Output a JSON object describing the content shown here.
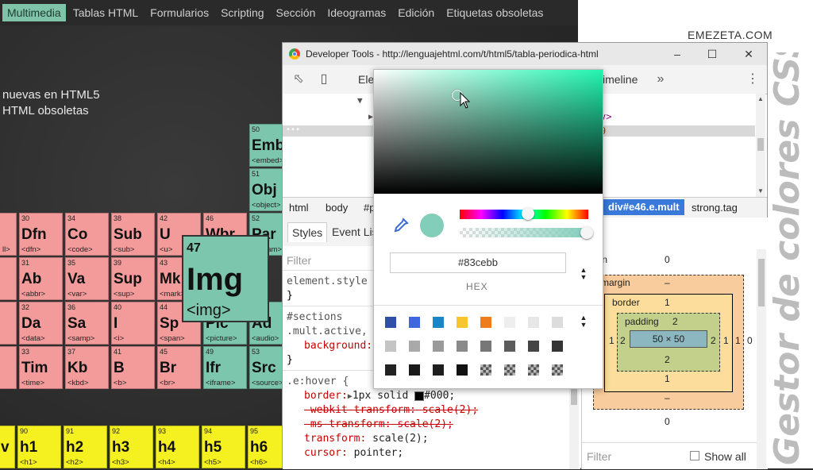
{
  "nav": {
    "items": [
      "Multimedia",
      "Tablas HTML",
      "Formularios",
      "Scripting",
      "Sección",
      "Ideogramas",
      "Edición",
      "Etiquetas obsoletas"
    ]
  },
  "intro": {
    "line1": "nuevas en HTML5",
    "line2": "HTML obsoletas"
  },
  "brand": "EMEZETA.COM",
  "vertical_title": "Gestor de colores CSS",
  "elements": [
    {
      "num": "30",
      "sym": "Dfn",
      "tag": "<dfn>",
      "color": "pink"
    },
    {
      "num": "34",
      "sym": "Co",
      "tag": "<code>",
      "color": "pink"
    },
    {
      "num": "38",
      "sym": "Sub",
      "tag": "<sub>",
      "color": "pink"
    },
    {
      "num": "42",
      "sym": "U",
      "tag": "<u>",
      "color": "pink"
    },
    {
      "num": "46",
      "sym": "Wbr",
      "tag": "<wbr>",
      "color": "pink"
    },
    {
      "num": "52",
      "sym": "Par",
      "tag": "<param>",
      "color": "teal"
    },
    {
      "num": "31",
      "sym": "Ab",
      "tag": "<abbr>",
      "color": "pink"
    },
    {
      "num": "35",
      "sym": "Va",
      "tag": "<var>",
      "color": "pink"
    },
    {
      "num": "39",
      "sym": "Sup",
      "tag": "<sup>",
      "color": "pink"
    },
    {
      "num": "43",
      "sym": "Mk",
      "tag": "<mark>",
      "color": "pink"
    },
    {
      "num": "32",
      "sym": "Da",
      "tag": "<data>",
      "color": "pink"
    },
    {
      "num": "36",
      "sym": "Sa",
      "tag": "<samp>",
      "color": "pink"
    },
    {
      "num": "40",
      "sym": "I",
      "tag": "<i>",
      "color": "pink"
    },
    {
      "num": "44",
      "sym": "Sp",
      "tag": "<span>",
      "color": "pink"
    },
    {
      "num": "48",
      "sym": "Pic",
      "tag": "<picture>",
      "color": "teal"
    },
    {
      "num": "",
      "sym": "Ad",
      "tag": "<audio>",
      "color": "teal"
    },
    {
      "num": "33",
      "sym": "Tim",
      "tag": "<time>",
      "color": "pink"
    },
    {
      "num": "37",
      "sym": "Kb",
      "tag": "<kbd>",
      "color": "pink"
    },
    {
      "num": "41",
      "sym": "B",
      "tag": "<b>",
      "color": "pink"
    },
    {
      "num": "45",
      "sym": "Br",
      "tag": "<br>",
      "color": "pink"
    },
    {
      "num": "49",
      "sym": "Ifr",
      "tag": "<iframe>",
      "color": "teal"
    },
    {
      "num": "53",
      "sym": "Src",
      "tag": "<source>",
      "color": "teal"
    },
    {
      "num": "50",
      "sym": "Emb",
      "tag": "<embed>",
      "color": "teal"
    },
    {
      "num": "51",
      "sym": "Obj",
      "tag": "<object>",
      "color": "teal"
    },
    {
      "num": "90",
      "sym": "h1",
      "tag": "<h1>",
      "color": "yellow"
    },
    {
      "num": "91",
      "sym": "h2",
      "tag": "<h2>",
      "color": "yellow"
    },
    {
      "num": "92",
      "sym": "h3",
      "tag": "<h3>",
      "color": "yellow"
    },
    {
      "num": "93",
      "sym": "h4",
      "tag": "<h4>",
      "color": "yellow"
    },
    {
      "num": "94",
      "sym": "h5",
      "tag": "<h5>",
      "color": "yellow"
    },
    {
      "num": "95",
      "sym": "h6",
      "tag": "<h6>",
      "color": "yellow"
    }
  ],
  "partial_labels": {
    "left1": "ll>",
    "left2": "",
    "yellow_v": "v"
  },
  "featured": {
    "num": "47",
    "sym": "Img",
    "tag": "<img>"
  },
  "devtools": {
    "title": "Developer Tools - http://lenguajehtml.com/t/html5/tabla-periodica-html",
    "tab_elements": "Ele",
    "tab_timeline": "imeline",
    "dom_snip1": "v>",
    "dom_snip2": "9",
    "crumbs": [
      "html",
      "body",
      "#p",
      "div#e46.e.mult",
      "strong.tag"
    ],
    "style_tabs": [
      "Styles",
      "Event Lis"
    ],
    "styles_filter": "Filter",
    "rule1_selector": "element.style",
    "rule1_close": "}",
    "rule2_selector1": "#sections",
    "rule2_selector2": ".mult.active,",
    "rule2_prop": "background:",
    "rule2_close": "}",
    "rule3_selector": ".e:hover {",
    "rule3_lines": [
      {
        "prop": "border:",
        "val": "1px solid",
        "swatch": "#000000",
        "val2": "#000;",
        "strike": false
      },
      {
        "prop": "-webkit-transform:",
        "val": "scale(2);",
        "strike": true
      },
      {
        "prop": "-ms-transform:",
        "val": "scale(2);",
        "strike": true
      },
      {
        "prop": "transform:",
        "val": "scale(2);",
        "strike": false
      },
      {
        "prop": "cursor:",
        "val": "pointer;",
        "strike": false
      }
    ],
    "boxmodel": {
      "position_label": "sition",
      "position_val": "0",
      "margin_label": "margin",
      "margin_top": "–",
      "margin_bottom": "–",
      "border_label": "border",
      "border_val": "1",
      "padding_label": "padding",
      "padding_val": "2",
      "content": "50 × 50",
      "left_border": "1",
      "left_padding": "2",
      "right_padding": "2",
      "right_border": "1",
      "right_margin": "1",
      "right_pos": "0",
      "padding_bottom": "2",
      "border_bottom": "1",
      "position_bottom": "0",
      "filter": "Filter",
      "show_all": "Show all"
    }
  },
  "picker": {
    "hex_value": "#83cebb",
    "hex_label": "HEX",
    "current_color": "#83cebb",
    "palette": [
      [
        "#2f4fa8",
        "#3f68e0",
        "#1a86c8",
        "#f7c52e",
        "#ef7d1b",
        "#eeeeee",
        "#e7e7e7",
        "#dcdcdc"
      ],
      [
        "#c4c4c4",
        "#a9a9a9",
        "#9a9a9a",
        "#8a8a8a",
        "#777777",
        "#5c5c5c",
        "#454545",
        "#343434"
      ],
      [
        "#222222",
        "#1a1a1a",
        "#1e1e1e",
        "#111111",
        "checker",
        "checker",
        "checker",
        "checker"
      ]
    ]
  }
}
